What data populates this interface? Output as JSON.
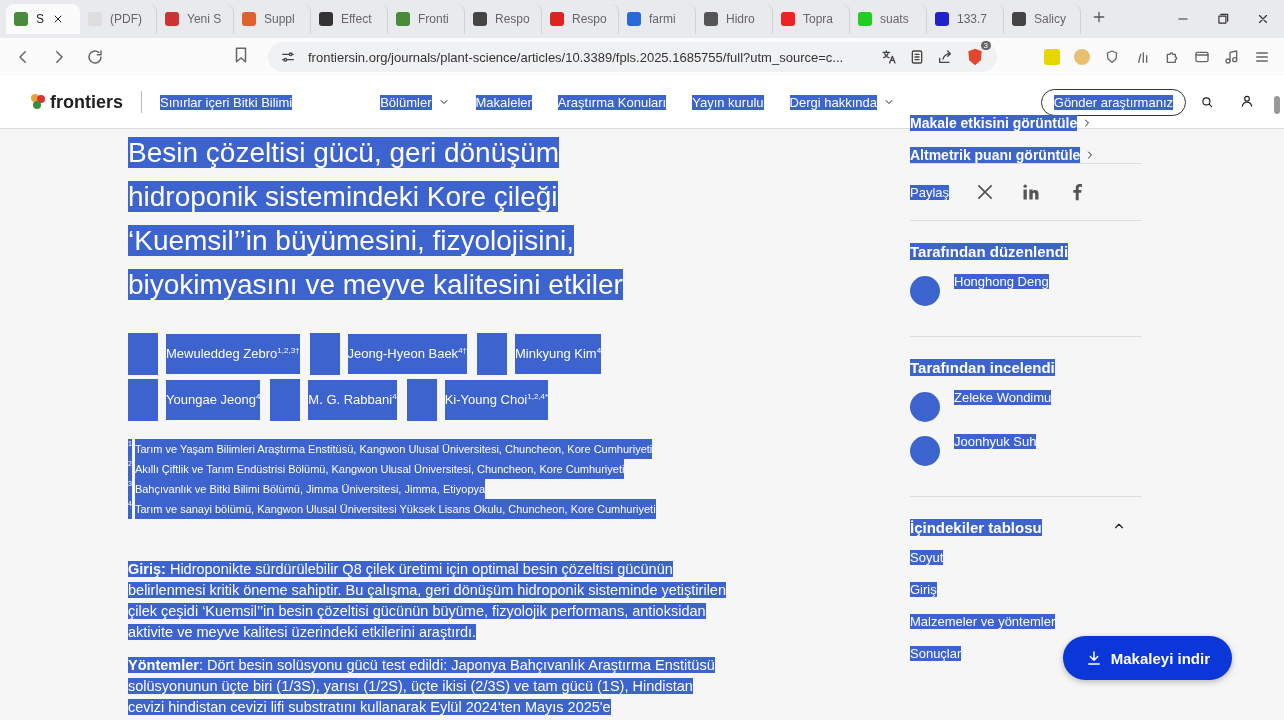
{
  "browser": {
    "tabs": [
      {
        "title": "S",
        "selected": true
      },
      {
        "title": "(PDF)",
        "selected": false
      },
      {
        "title": "Yeni S",
        "selected": false
      },
      {
        "title": "Suppl",
        "selected": false
      },
      {
        "title": "Effect",
        "selected": false
      },
      {
        "title": "Fronti",
        "selected": false
      },
      {
        "title": "Respo",
        "selected": false
      },
      {
        "title": "Respo",
        "selected": false
      },
      {
        "title": "farmi",
        "selected": false
      },
      {
        "title": "Hidro",
        "selected": false
      },
      {
        "title": "Topra",
        "selected": false
      },
      {
        "title": "suats",
        "selected": false
      },
      {
        "title": "133.7",
        "selected": false
      },
      {
        "title": "Salicy",
        "selected": false
      }
    ],
    "address": "frontiersin.org/journals/plant-science/articles/10.3389/fpls.2025.1685755/full?utm_source=c...",
    "shield_badge": "3"
  },
  "text_selected": true,
  "site": {
    "logo": "frontiers",
    "journal": "Sınırlar içeri Bitki Bilimi",
    "nav": [
      {
        "label": "Bölümler",
        "dropdown": true
      },
      {
        "label": "Makaleler",
        "dropdown": false
      },
      {
        "label": "Araştırma Konuları",
        "dropdown": false
      },
      {
        "label": "Yayın kurulu",
        "dropdown": false
      },
      {
        "label": "Dergi hakkında",
        "dropdown": true
      }
    ],
    "submit_button": "Gönder araştırmanız"
  },
  "article": {
    "title": "Besin çözeltisi gücü, geri dönüşüm hidroponik sistemindeki Kore çileği ‘Kuemsil’’in büyümesini, fizyolojisini, biyokimyasını ve meyve kalitesini etkiler",
    "authors": [
      {
        "name": "Mewuleddeg Zebro",
        "marks": "1,2,3†"
      },
      {
        "name": "Jeong-Hyeon Baek",
        "marks": "4†"
      },
      {
        "name": "Minkyung Kim",
        "marks": "4"
      },
      {
        "name": "Youngae Jeong",
        "marks": "4"
      },
      {
        "name": "M. G. Rabbani",
        "marks": "4"
      },
      {
        "name": "Ki-Young Choi",
        "marks": "1,2,4*"
      }
    ],
    "affiliations": [
      {
        "number": "1",
        "text": "Tarım ve Yaşam Bilimleri Araştırma Enstitüsü, Kangwon Ulusal Üniversitesi, Chuncheon, Kore Cumhuriyeti"
      },
      {
        "number": "2",
        "text": "Akıllı Çiftlik ve Tarım Endüstrisi Bölümü, Kangwon Ulusal Üniversitesi, Chuncheon, Kore Cumhuriyeti"
      },
      {
        "number": "3",
        "text": "Bahçıvanlık ve Bitki Bilimi Bölümü, Jimma Üniversitesi, Jimma, Etiyopya"
      },
      {
        "number": "4",
        "text": "Tarım ve sanayi bölümü, Kangwon Ulusal Üniversitesi Yüksek Lisans Okulu, Chuncheon, Kore Cumhuriyeti"
      }
    ],
    "abstract": [
      "**Giriş:** Hidroponikte sürdürülebilir Q8 çilek üretimi için optimal besin çözeltisi gücünün belirlenmesi kritik öneme sahiptir. Bu çalışma, geri dönüşüm hidroponik sisteminde yetiştirilen çilek çeşidi ‘Kuemsil’’in besin çözeltisi gücünün büyüme, fizyolojik performans, antioksidan aktivite ve meyve kalitesi üzerindeki etkilerini araştırdı.",
      "**Yöntemler**: Dört besin solüsyonu gücü test edildi: Japonya Bahçıvanlık Araştırma Enstitüsü solüsyonunun üçte biri (1/3S), yarısı (1/2S), üçte ikisi (2/3S) ve tam gücü (1S), Hindistan cevizi hindistan cevizi lifi substratını kullanarak Eylül 2024'ten Mayıs 2025'e"
    ]
  },
  "sidebar": {
    "impact_links": [
      "Makale etkisini görüntüle",
      "Altmetrik puanı görüntüle"
    ],
    "share_label": "Paylaş",
    "people_sections": [
      {
        "heading": "Tarafından düzenlendi",
        "people": [
          "Honghong Deng"
        ]
      },
      {
        "heading": "Tarafından incelendi",
        "people": [
          "Zeleke Wondimu",
          "Joonhyuk Suh"
        ]
      }
    ],
    "toc": {
      "heading": "İçindekiler tablosu",
      "expanded": true,
      "items": [
        "Soyut",
        "Giriş",
        "Malzemeler ve yöntemler",
        "Sonuçlar"
      ]
    }
  },
  "download_button": "Makaleyi indir"
}
